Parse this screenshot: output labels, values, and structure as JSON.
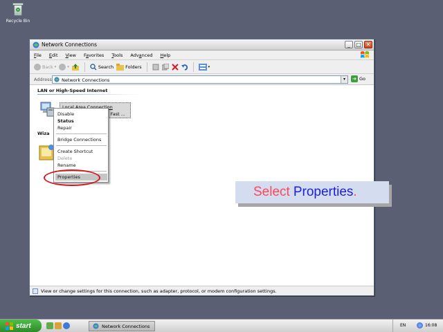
{
  "desktop": {
    "recycle_bin_label": "Recycle Bin"
  },
  "window": {
    "title": "Network Connections",
    "menu": [
      {
        "pre": "",
        "key": "F",
        "post": "ile"
      },
      {
        "pre": "",
        "key": "E",
        "post": "dit"
      },
      {
        "pre": "",
        "key": "V",
        "post": "iew"
      },
      {
        "pre": "F",
        "key": "a",
        "post": "vorites"
      },
      {
        "pre": "",
        "key": "T",
        "post": "ools"
      },
      {
        "pre": "Adv",
        "key": "a",
        "post": "nced"
      },
      {
        "pre": "",
        "key": "H",
        "post": "elp"
      }
    ],
    "toolbar": {
      "back": "Back",
      "search": "Search",
      "folders": "Folders"
    },
    "address": {
      "label": "Address",
      "value": "Network Connections",
      "go": "Go"
    },
    "content": {
      "group_lan": "LAN or High-Speed Internet",
      "group_wizard_partial": "Wiza",
      "connection_name": "Local Area Connection",
      "connection_sub_partial": "d Fast ...",
      "wizard_partial": "d"
    },
    "status_text": "View or change settings for this connection, such as adapter, protocol, or modem configuration settings."
  },
  "context_menu": {
    "disable": "Disable",
    "status": "Status",
    "repair": "Repair",
    "bridge": "Bridge Connections",
    "shortcut": "Create Shortcut",
    "delete": "Delete",
    "rename": "Rename",
    "properties": "Properties"
  },
  "callout": {
    "part1": "Select",
    "part2": "Properties",
    "part3": "."
  },
  "taskbar": {
    "start": "start",
    "task": "Network Connections",
    "lang": "EN",
    "clock": "16:08"
  }
}
